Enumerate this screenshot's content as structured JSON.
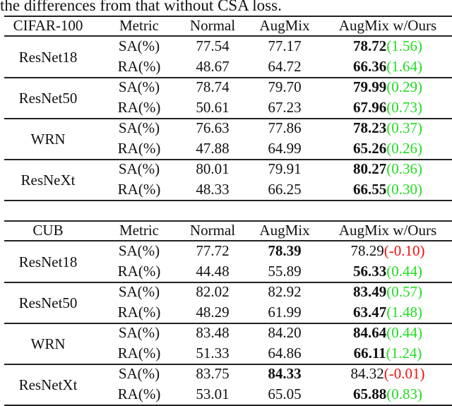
{
  "caption": "the differences from that without CSA loss.",
  "colors": {
    "positive": "#22dd22",
    "negative": "#ee1111"
  },
  "tables": [
    {
      "header": [
        "CIFAR-100",
        "Metric",
        "Normal",
        "AugMix",
        "AugMix w/Ours"
      ],
      "groups": [
        {
          "model": "ResNet18",
          "rows": [
            {
              "metric": "SA(%)",
              "normal": "77.54",
              "augmix": "77.17",
              "augmix_bold": false,
              "ours": "78.72",
              "ours_bold": true,
              "diff": "(1.56)",
              "diff_sign": "pos"
            },
            {
              "metric": "RA(%)",
              "normal": "48.67",
              "augmix": "64.72",
              "augmix_bold": false,
              "ours": "66.36",
              "ours_bold": true,
              "diff": "(1.64)",
              "diff_sign": "pos"
            }
          ]
        },
        {
          "model": "ResNet50",
          "rows": [
            {
              "metric": "SA(%)",
              "normal": "78.74",
              "augmix": "79.70",
              "augmix_bold": false,
              "ours": "79.99",
              "ours_bold": true,
              "diff": "(0.29)",
              "diff_sign": "pos"
            },
            {
              "metric": "RA(%)",
              "normal": "50.61",
              "augmix": "67.23",
              "augmix_bold": false,
              "ours": "67.96",
              "ours_bold": true,
              "diff": "(0.73)",
              "diff_sign": "pos"
            }
          ]
        },
        {
          "model": "WRN",
          "rows": [
            {
              "metric": "SA(%)",
              "normal": "76.63",
              "augmix": "77.86",
              "augmix_bold": false,
              "ours": "78.23",
              "ours_bold": true,
              "diff": "(0.37)",
              "diff_sign": "pos"
            },
            {
              "metric": "RA(%)",
              "normal": "47.88",
              "augmix": "64.99",
              "augmix_bold": false,
              "ours": "65.26",
              "ours_bold": true,
              "diff": "(0.26)",
              "diff_sign": "pos"
            }
          ]
        },
        {
          "model": "ResNeXt",
          "rows": [
            {
              "metric": "SA(%)",
              "normal": "80.01",
              "augmix": "79.91",
              "augmix_bold": false,
              "ours": "80.27",
              "ours_bold": true,
              "diff": "(0.36)",
              "diff_sign": "pos"
            },
            {
              "metric": "RA(%)",
              "normal": "48.33",
              "augmix": "66.25",
              "augmix_bold": false,
              "ours": "66.55",
              "ours_bold": true,
              "diff": "(0.30)",
              "diff_sign": "pos"
            }
          ]
        }
      ]
    },
    {
      "header": [
        "CUB",
        "Metric",
        "Normal",
        "AugMix",
        "AugMix w/Ours"
      ],
      "groups": [
        {
          "model": "ResNet18",
          "rows": [
            {
              "metric": "SA(%)",
              "normal": "77.72",
              "augmix": "78.39",
              "augmix_bold": true,
              "ours": "78.29",
              "ours_bold": false,
              "diff": "(-0.10)",
              "diff_sign": "neg"
            },
            {
              "metric": "RA(%)",
              "normal": "44.48",
              "augmix": "55.89",
              "augmix_bold": false,
              "ours": "56.33",
              "ours_bold": true,
              "diff": "(0.44)",
              "diff_sign": "pos"
            }
          ]
        },
        {
          "model": "ResNet50",
          "rows": [
            {
              "metric": "SA(%)",
              "normal": "82.02",
              "augmix": "82.92",
              "augmix_bold": false,
              "ours": "83.49",
              "ours_bold": true,
              "diff": "(0.57)",
              "diff_sign": "pos"
            },
            {
              "metric": "RA(%)",
              "normal": "48.29",
              "augmix": "61.99",
              "augmix_bold": false,
              "ours": "63.47",
              "ours_bold": true,
              "diff": "(1.48)",
              "diff_sign": "pos"
            }
          ]
        },
        {
          "model": "WRN",
          "rows": [
            {
              "metric": "SA(%)",
              "normal": "83.48",
              "augmix": "84.20",
              "augmix_bold": false,
              "ours": "84.64",
              "ours_bold": true,
              "diff": "(0.44)",
              "diff_sign": "pos"
            },
            {
              "metric": "RA(%)",
              "normal": "51.33",
              "augmix": "64.86",
              "augmix_bold": false,
              "ours": "66.11",
              "ours_bold": true,
              "diff": "(1.24)",
              "diff_sign": "pos"
            }
          ]
        },
        {
          "model": "ResNetXt",
          "rows": [
            {
              "metric": "SA(%)",
              "normal": "83.75",
              "augmix": "84.33",
              "augmix_bold": true,
              "ours": "84.32",
              "ours_bold": false,
              "diff": "(-0.01)",
              "diff_sign": "neg"
            },
            {
              "metric": "RA(%)",
              "normal": "53.01",
              "augmix": "65.05",
              "augmix_bold": false,
              "ours": "65.88",
              "ours_bold": true,
              "diff": "(0.83)",
              "diff_sign": "pos"
            }
          ]
        }
      ]
    }
  ]
}
